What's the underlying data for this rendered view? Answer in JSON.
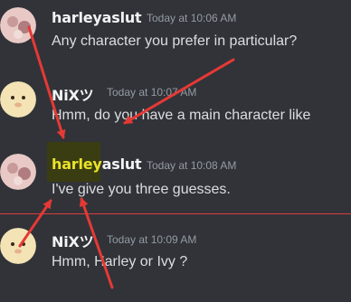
{
  "messages": [
    {
      "author": "harleyaslut",
      "timestamp": "Today at 10:06 AM",
      "text": "Any character you prefer in particular?"
    },
    {
      "author": "NiXツ",
      "timestamp": "Today at 10:07 AM",
      "text": "Hmm, do you have a main character like"
    },
    {
      "author_highlight": "harley",
      "author_rest": "aslut",
      "timestamp": "Today at 10:08 AM",
      "text": "I've give you three guesses."
    },
    {
      "author": "NiXツ",
      "timestamp": "Today at 10:09 AM",
      "text": "Hmm, Harley or Ivy ?"
    }
  ],
  "colors": {
    "background": "#313338",
    "highlight": "#e9e32a",
    "new_divider": "#d83c3e",
    "annotation_arrows": "#e53935"
  }
}
